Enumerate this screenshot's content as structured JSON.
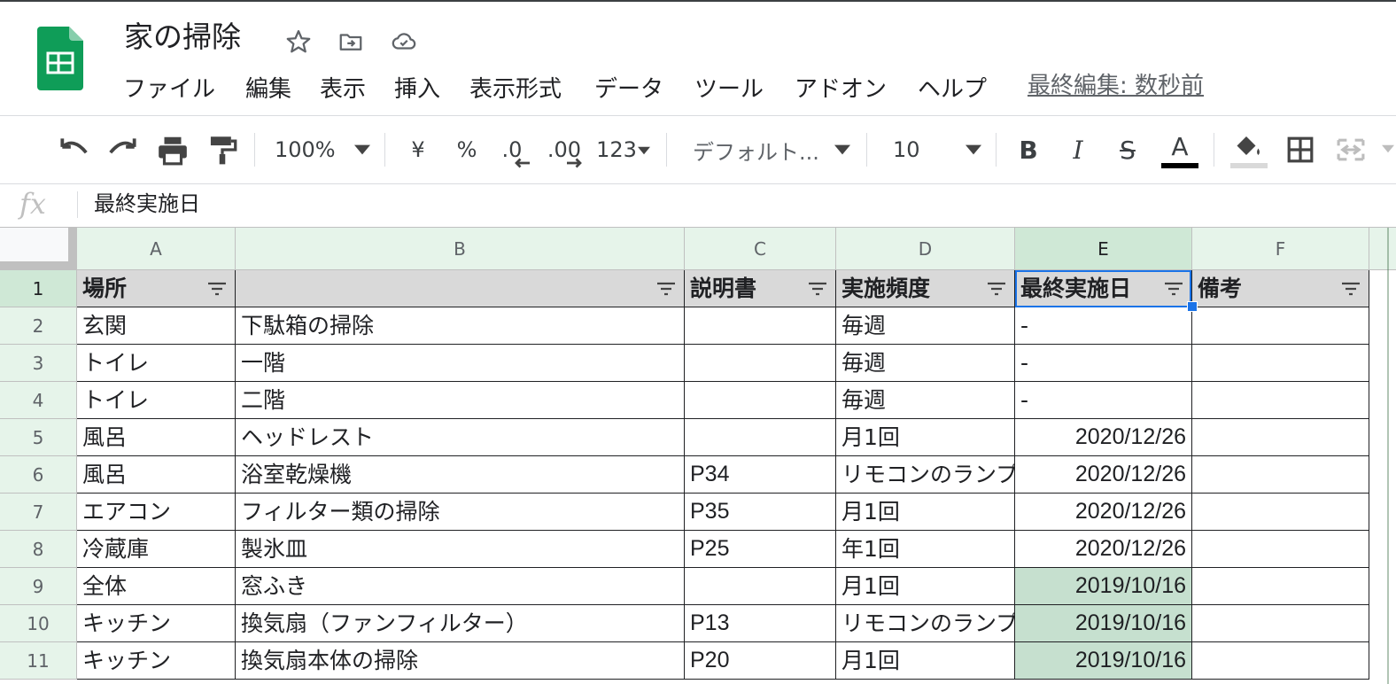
{
  "header": {
    "doc_title": "家の掃除",
    "last_edit": "最終編集: 数秒前",
    "menu": [
      "ファイル",
      "編集",
      "表示",
      "挿入",
      "表示形式",
      "データ",
      "ツール",
      "アドオン",
      "ヘルプ"
    ]
  },
  "toolbar": {
    "zoom": "100%",
    "currency": "¥",
    "percent": "%",
    "decimal_decrease": ".0",
    "decimal_increase": ".00",
    "number_format": "123",
    "font": "デフォルト...",
    "font_size": "10",
    "bold": "B",
    "italic": "I",
    "strike": "S",
    "text_color": "A"
  },
  "formula_bar": {
    "fx": "fx",
    "value": "最終実施日"
  },
  "grid": {
    "columns": [
      "A",
      "B",
      "C",
      "D",
      "E",
      "F"
    ],
    "selected_column": "E",
    "rows": [
      {
        "num": "1",
        "cells": [
          "場所",
          "",
          "説明書",
          "実施頻度",
          "最終実施日",
          "備考"
        ]
      },
      {
        "num": "2",
        "cells": [
          "玄関",
          "下駄箱の掃除",
          "",
          "毎週",
          "-",
          ""
        ]
      },
      {
        "num": "3",
        "cells": [
          "トイレ",
          "一階",
          "",
          "毎週",
          "-",
          ""
        ]
      },
      {
        "num": "4",
        "cells": [
          "トイレ",
          "二階",
          "",
          "毎週",
          "-",
          ""
        ]
      },
      {
        "num": "5",
        "cells": [
          "風呂",
          "ヘッドレスト",
          "",
          "月1回",
          "2020/12/26",
          ""
        ]
      },
      {
        "num": "6",
        "cells": [
          "風呂",
          "浴室乾燥機",
          "P34",
          "リモコンのランプ",
          "2020/12/26",
          ""
        ]
      },
      {
        "num": "7",
        "cells": [
          "エアコン",
          "フィルター類の掃除",
          "P35",
          "月1回",
          "2020/12/26",
          ""
        ]
      },
      {
        "num": "8",
        "cells": [
          "冷蔵庫",
          "製氷皿",
          "P25",
          "年1回",
          "2020/12/26",
          ""
        ]
      },
      {
        "num": "9",
        "cells": [
          "全体",
          "窓ふき",
          "",
          "月1回",
          "2019/10/16",
          ""
        ]
      },
      {
        "num": "10",
        "cells": [
          "キッチン",
          "換気扇（ファンフィルター）",
          "P13",
          "リモコンのランプ",
          "2019/10/16",
          ""
        ]
      },
      {
        "num": "11",
        "cells": [
          "キッチン",
          "換気扇本体の掃除",
          "P20",
          "月1回",
          "2019/10/16",
          ""
        ]
      }
    ],
    "highlight_color": "#c6e0cf",
    "header_row_color": "#d9d9d9",
    "selection_color": "#1a73e8"
  },
  "colors": {
    "sheets_green": "#0f9d58",
    "accent_blue": "#1a73e8"
  },
  "icons": {
    "title": [
      "star-icon",
      "move-to-folder-icon",
      "cloud-saved-icon"
    ],
    "toolbar": [
      "undo-icon",
      "redo-icon",
      "print-icon",
      "paint-format-icon",
      "fill-color-icon",
      "borders-icon",
      "merge-cells-icon"
    ]
  }
}
